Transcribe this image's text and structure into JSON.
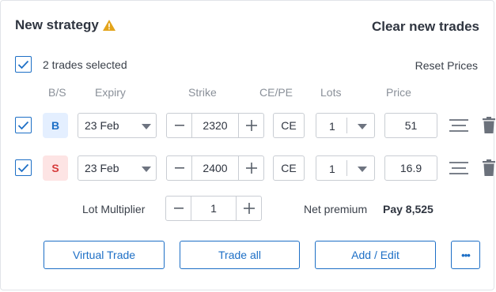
{
  "header": {
    "title": "New strategy",
    "warning_icon": "warning-icon",
    "clear_label": "Clear new trades"
  },
  "selection": {
    "text": "2 trades selected",
    "all_checked": true,
    "reset_label": "Reset Prices"
  },
  "columns": {
    "bs": "B/S",
    "expiry": "Expiry",
    "strike": "Strike",
    "cepe": "CE/PE",
    "lots": "Lots",
    "price": "Price"
  },
  "trades": [
    {
      "checked": true,
      "side": "B",
      "expiry": "23 Feb",
      "strike": "2320",
      "type": "CE",
      "lots": "1",
      "price": "51"
    },
    {
      "checked": true,
      "side": "S",
      "expiry": "23 Feb",
      "strike": "2400",
      "type": "CE",
      "lots": "1",
      "price": "16.9"
    }
  ],
  "multiplier": {
    "label": "Lot Multiplier",
    "value": "1",
    "minus": "—",
    "plus": "+"
  },
  "premium": {
    "label": "Net premium",
    "value": "Pay 8,525"
  },
  "actions": {
    "virtual_trade": "Virtual Trade",
    "trade_all": "Trade all",
    "add_edit": "Add / Edit",
    "more": "•••"
  },
  "colors": {
    "accent": "#1d6fc6",
    "buy_bg": "#e4efff",
    "sell_bg": "#fde4e4",
    "sell_text": "#d63b3b",
    "warning": "#e3a41b"
  },
  "icons": [
    "warning-icon",
    "checkmark-icon",
    "chevron-down-icon",
    "minus-icon",
    "plus-icon",
    "drag-handle-icon",
    "trash-icon",
    "more-icon"
  ]
}
